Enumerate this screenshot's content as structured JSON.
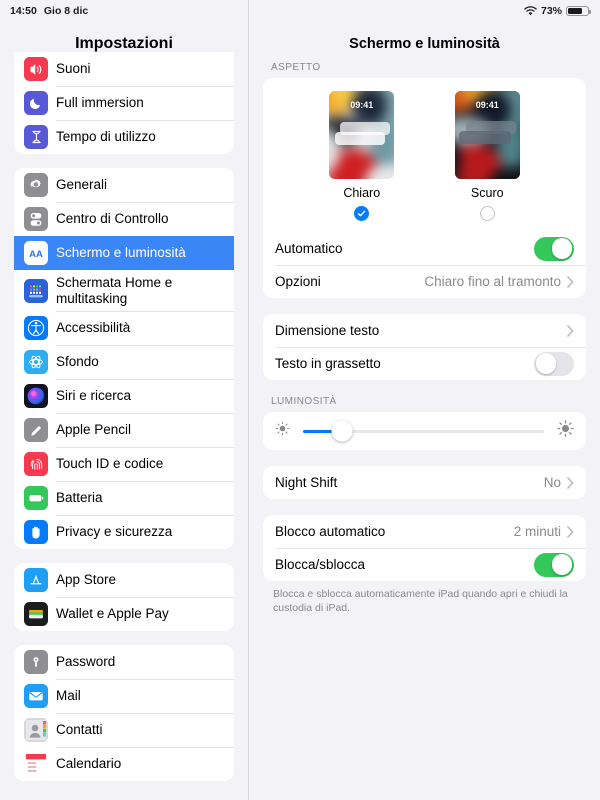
{
  "status_bar": {
    "time": "14:50",
    "date": "Gio 8 dic",
    "wifi_icon": "wifi-icon",
    "battery_percent": "73%",
    "battery_icon": "battery-icon"
  },
  "sidebar": {
    "title": "Impostazioni",
    "groups": [
      {
        "items": [
          {
            "label": "Suoni",
            "icon": "speaker-icon",
            "color": "#f5394f",
            "selected": false
          },
          {
            "label": "Full immersion",
            "icon": "moon-icon",
            "color": "#5857d6",
            "selected": false
          },
          {
            "label": "Tempo di utilizzo",
            "icon": "hourglass-icon",
            "color": "#5857d6",
            "selected": false
          }
        ]
      },
      {
        "items": [
          {
            "label": "Generali",
            "icon": "gear-icon",
            "color": "#8e8e93",
            "selected": false
          },
          {
            "label": "Centro di Controllo",
            "icon": "control-center-icon",
            "color": "#8e8e93",
            "selected": false
          },
          {
            "label": "Schermo e luminosità",
            "icon": "display-aa-icon",
            "color": "#ffffff",
            "selected": true
          },
          {
            "label": "Schermata Home e multitasking",
            "icon": "home-screen-icon",
            "color": "#2b62d9",
            "selected": false
          },
          {
            "label": "Accessibilità",
            "icon": "accessibility-icon",
            "color": "#047bfd",
            "selected": false
          },
          {
            "label": "Sfondo",
            "icon": "wallpaper-icon",
            "color": "#2eadef",
            "selected": false
          },
          {
            "label": "Siri e ricerca",
            "icon": "siri-icon",
            "color": "#1b1b2b",
            "selected": false
          },
          {
            "label": "Apple Pencil",
            "icon": "pencil-icon",
            "color": "#8e8e93",
            "selected": false
          },
          {
            "label": "Touch ID e codice",
            "icon": "fingerprint-icon",
            "color": "#f5394f",
            "selected": false
          },
          {
            "label": "Batteria",
            "icon": "battery-green-icon",
            "color": "#34c759",
            "selected": false
          },
          {
            "label": "Privacy e sicurezza",
            "icon": "hand-icon",
            "color": "#047bfd",
            "selected": false
          }
        ]
      },
      {
        "items": [
          {
            "label": "App Store",
            "icon": "app-store-icon",
            "color": "#1e9ef5",
            "selected": false
          },
          {
            "label": "Wallet e Apple Pay",
            "icon": "wallet-icon",
            "color": "#1c1c1e",
            "selected": false
          }
        ]
      },
      {
        "items": [
          {
            "label": "Password",
            "icon": "key-icon",
            "color": "#8e8e93",
            "selected": false
          },
          {
            "label": "Mail",
            "icon": "mail-icon",
            "color": "#1e9ef5",
            "selected": false
          },
          {
            "label": "Contatti",
            "icon": "contacts-icon",
            "color": "#bfbfc4",
            "selected": false
          },
          {
            "label": "Calendario",
            "icon": "calendar-icon",
            "color": "#ffffff",
            "selected": false
          }
        ]
      }
    ]
  },
  "detail": {
    "title": "Schermo e luminosità",
    "appearance_section": {
      "header": "ASPETTO",
      "options": [
        {
          "name": "Chiaro",
          "selected": true
        },
        {
          "name": "Scuro",
          "selected": false
        }
      ],
      "thumb_clock": "09:41",
      "automatic": {
        "label": "Automatico",
        "on": true
      },
      "options_row": {
        "label": "Opzioni",
        "value": "Chiaro fino al tramonto",
        "chevron": "chevron-right-icon"
      }
    },
    "text_section": {
      "text_size": {
        "label": "Dimensione testo",
        "chevron": "chevron-right-icon"
      },
      "bold_text": {
        "label": "Testo in grassetto",
        "on": false
      }
    },
    "brightness_section": {
      "header": "LUMINOSITÀ",
      "value_percent": 16,
      "low_icon": "sun-low-icon",
      "high_icon": "sun-high-icon"
    },
    "night_shift": {
      "label": "Night Shift",
      "value": "No",
      "chevron": "chevron-right-icon"
    },
    "lock_section": {
      "auto_lock": {
        "label": "Blocco automatico",
        "value": "2 minuti",
        "chevron": "chevron-right-icon"
      },
      "lock_unlock": {
        "label": "Blocca/sblocca",
        "on": true
      },
      "footnote": "Blocca e sblocca automaticamente iPad quando apri e chiudi la custodia di iPad."
    }
  },
  "colors": {
    "accent_blue": "#007aff",
    "selected_row": "#3b86f7",
    "switch_on": "#34c759",
    "page_bg": "#f2f2f7"
  }
}
